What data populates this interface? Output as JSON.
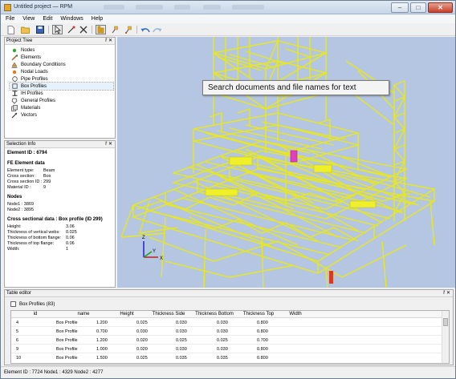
{
  "window": {
    "title": "Untitled project — RPM",
    "controls": {
      "minimize": "–",
      "maximize": "□",
      "close": "✕"
    }
  },
  "menu": [
    "File",
    "View",
    "Edit",
    "Windows",
    "Help"
  ],
  "project_tree": {
    "title": "Project Tree",
    "controls": "ř ✕",
    "items": [
      {
        "label": "Nodes",
        "icon": "node-dot-icon",
        "color": "#2eaa2e"
      },
      {
        "label": "Elements",
        "icon": "element-icon",
        "color": "#b85a2a"
      },
      {
        "label": "Boundary Conditions",
        "icon": "boundary-icon",
        "color": "#8a6d3a"
      },
      {
        "label": "Nodal Loads",
        "icon": "load-dot-icon",
        "color": "#e07a1a"
      },
      {
        "label": "Pipe Profiles",
        "icon": "pipe-icon",
        "color": "#555555"
      },
      {
        "label": "Box Profiles",
        "icon": "box-icon",
        "color": "#555555",
        "selected": true
      },
      {
        "label": "IH Profiles",
        "icon": "ih-icon",
        "color": "#333333"
      },
      {
        "label": "General Profiles",
        "icon": "general-icon",
        "color": "#555555"
      },
      {
        "label": "Materials",
        "icon": "materials-icon",
        "color": "#555555"
      },
      {
        "label": "Vectors",
        "icon": "vector-icon",
        "color": "#333333"
      }
    ]
  },
  "selection_info": {
    "title": "Selection Info",
    "controls": "ř ✕",
    "element_id": "Element ID : 6794",
    "fe_heading": "FE Element data",
    "fe_rows": [
      {
        "label": "Element type:",
        "value": "Beam"
      },
      {
        "label": "Cross section:",
        "value": "Box"
      },
      {
        "label": "Cross section ID :",
        "value": "299"
      },
      {
        "label": "Material ID :",
        "value": "9"
      }
    ],
    "nodes_heading": "Nodes",
    "nodes": [
      "Node1 : 3869",
      "Node2 : 3895"
    ],
    "cs_heading": "Cross sectional data : Box profile (ID 299)",
    "cs_rows": [
      {
        "label": "Height:",
        "value": "3.06"
      },
      {
        "label": "Thickness of vertical webs:",
        "value": "0.025"
      },
      {
        "label": "Thickness of bottom flange:",
        "value": "0.06"
      },
      {
        "label": "Thickness of top flange:",
        "value": "0.06"
      },
      {
        "label": "Width:",
        "value": "1"
      }
    ]
  },
  "viewport": {
    "tooltip": "Search documents and file names for text",
    "axes": {
      "x": "X",
      "y": "Y",
      "z": "Z"
    },
    "background": "#b4c6e1",
    "structure_color": "#f2f22a",
    "highlight_color": "#e040c0"
  },
  "table_editor": {
    "title": "Table editor",
    "controls": "ř ✕",
    "tab_label": "Box Profiles (83)",
    "columns": [
      "id",
      "name",
      "Height",
      "Thickness Side",
      "Thickness Bottom",
      "Thickness Top",
      "Width"
    ],
    "rows": [
      [
        "4",
        "Box Profile",
        "1.200",
        "0.025",
        "0.030",
        "0.030",
        "0.800"
      ],
      [
        "5",
        "Box Profile",
        "0.700",
        "0.030",
        "0.030",
        "0.030",
        "0.800"
      ],
      [
        "6",
        "Box Profile",
        "1.200",
        "0.020",
        "0.025",
        "0.025",
        "0.700"
      ],
      [
        "9",
        "Box Profile",
        "1.000",
        "0.020",
        "0.030",
        "0.030",
        "0.800"
      ],
      [
        "10",
        "Box Profile",
        "1.500",
        "0.025",
        "0.035",
        "0.035",
        "0.800"
      ]
    ]
  },
  "status": "Element ID : 7724 Node1 : 4329 Node2 : 4277"
}
